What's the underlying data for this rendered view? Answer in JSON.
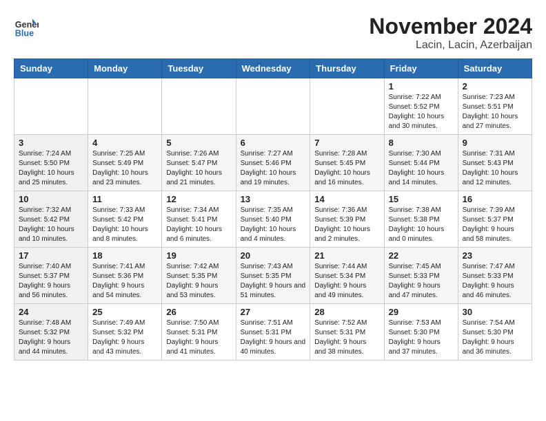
{
  "header": {
    "logo_line1": "General",
    "logo_line2": "Blue",
    "title": "November 2024",
    "subtitle": "Lacin, Lacin, Azerbaijan"
  },
  "calendar": {
    "days_of_week": [
      "Sunday",
      "Monday",
      "Tuesday",
      "Wednesday",
      "Thursday",
      "Friday",
      "Saturday"
    ],
    "weeks": [
      [
        {
          "day": "",
          "info": ""
        },
        {
          "day": "",
          "info": ""
        },
        {
          "day": "",
          "info": ""
        },
        {
          "day": "",
          "info": ""
        },
        {
          "day": "",
          "info": ""
        },
        {
          "day": "1",
          "info": "Sunrise: 7:22 AM\nSunset: 5:52 PM\nDaylight: 10 hours\nand 30 minutes."
        },
        {
          "day": "2",
          "info": "Sunrise: 7:23 AM\nSunset: 5:51 PM\nDaylight: 10 hours\nand 27 minutes."
        }
      ],
      [
        {
          "day": "3",
          "info": "Sunrise: 7:24 AM\nSunset: 5:50 PM\nDaylight: 10 hours\nand 25 minutes."
        },
        {
          "day": "4",
          "info": "Sunrise: 7:25 AM\nSunset: 5:49 PM\nDaylight: 10 hours\nand 23 minutes."
        },
        {
          "day": "5",
          "info": "Sunrise: 7:26 AM\nSunset: 5:47 PM\nDaylight: 10 hours\nand 21 minutes."
        },
        {
          "day": "6",
          "info": "Sunrise: 7:27 AM\nSunset: 5:46 PM\nDaylight: 10 hours\nand 19 minutes."
        },
        {
          "day": "7",
          "info": "Sunrise: 7:28 AM\nSunset: 5:45 PM\nDaylight: 10 hours\nand 16 minutes."
        },
        {
          "day": "8",
          "info": "Sunrise: 7:30 AM\nSunset: 5:44 PM\nDaylight: 10 hours\nand 14 minutes."
        },
        {
          "day": "9",
          "info": "Sunrise: 7:31 AM\nSunset: 5:43 PM\nDaylight: 10 hours\nand 12 minutes."
        }
      ],
      [
        {
          "day": "10",
          "info": "Sunrise: 7:32 AM\nSunset: 5:42 PM\nDaylight: 10 hours\nand 10 minutes."
        },
        {
          "day": "11",
          "info": "Sunrise: 7:33 AM\nSunset: 5:42 PM\nDaylight: 10 hours\nand 8 minutes."
        },
        {
          "day": "12",
          "info": "Sunrise: 7:34 AM\nSunset: 5:41 PM\nDaylight: 10 hours\nand 6 minutes."
        },
        {
          "day": "13",
          "info": "Sunrise: 7:35 AM\nSunset: 5:40 PM\nDaylight: 10 hours\nand 4 minutes."
        },
        {
          "day": "14",
          "info": "Sunrise: 7:36 AM\nSunset: 5:39 PM\nDaylight: 10 hours\nand 2 minutes."
        },
        {
          "day": "15",
          "info": "Sunrise: 7:38 AM\nSunset: 5:38 PM\nDaylight: 10 hours\nand 0 minutes."
        },
        {
          "day": "16",
          "info": "Sunrise: 7:39 AM\nSunset: 5:37 PM\nDaylight: 9 hours\nand 58 minutes."
        }
      ],
      [
        {
          "day": "17",
          "info": "Sunrise: 7:40 AM\nSunset: 5:37 PM\nDaylight: 9 hours\nand 56 minutes."
        },
        {
          "day": "18",
          "info": "Sunrise: 7:41 AM\nSunset: 5:36 PM\nDaylight: 9 hours\nand 54 minutes."
        },
        {
          "day": "19",
          "info": "Sunrise: 7:42 AM\nSunset: 5:35 PM\nDaylight: 9 hours\nand 53 minutes."
        },
        {
          "day": "20",
          "info": "Sunrise: 7:43 AM\nSunset: 5:35 PM\nDaylight: 9 hours\nand 51 minutes."
        },
        {
          "day": "21",
          "info": "Sunrise: 7:44 AM\nSunset: 5:34 PM\nDaylight: 9 hours\nand 49 minutes."
        },
        {
          "day": "22",
          "info": "Sunrise: 7:45 AM\nSunset: 5:33 PM\nDaylight: 9 hours\nand 47 minutes."
        },
        {
          "day": "23",
          "info": "Sunrise: 7:47 AM\nSunset: 5:33 PM\nDaylight: 9 hours\nand 46 minutes."
        }
      ],
      [
        {
          "day": "24",
          "info": "Sunrise: 7:48 AM\nSunset: 5:32 PM\nDaylight: 9 hours\nand 44 minutes."
        },
        {
          "day": "25",
          "info": "Sunrise: 7:49 AM\nSunset: 5:32 PM\nDaylight: 9 hours\nand 43 minutes."
        },
        {
          "day": "26",
          "info": "Sunrise: 7:50 AM\nSunset: 5:31 PM\nDaylight: 9 hours\nand 41 minutes."
        },
        {
          "day": "27",
          "info": "Sunrise: 7:51 AM\nSunset: 5:31 PM\nDaylight: 9 hours\nand 40 minutes."
        },
        {
          "day": "28",
          "info": "Sunrise: 7:52 AM\nSunset: 5:31 PM\nDaylight: 9 hours\nand 38 minutes."
        },
        {
          "day": "29",
          "info": "Sunrise: 7:53 AM\nSunset: 5:30 PM\nDaylight: 9 hours\nand 37 minutes."
        },
        {
          "day": "30",
          "info": "Sunrise: 7:54 AM\nSunset: 5:30 PM\nDaylight: 9 hours\nand 36 minutes."
        }
      ]
    ]
  }
}
